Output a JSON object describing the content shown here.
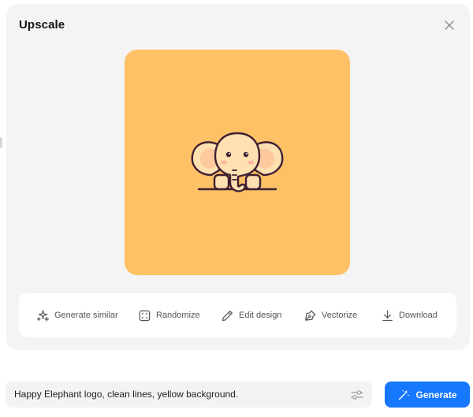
{
  "dialog": {
    "title": "Upscale"
  },
  "preview": {
    "background_color": "#fec166",
    "subject_icon": "elephant-logo"
  },
  "actions": [
    {
      "id": "generate-similar",
      "label": "Generate similar",
      "icon": "sparkles-icon"
    },
    {
      "id": "randomize",
      "label": "Randomize",
      "icon": "dice-icon"
    },
    {
      "id": "edit-design",
      "label": "Edit design",
      "icon": "pencil-icon"
    },
    {
      "id": "vectorize",
      "label": "Vectorize",
      "icon": "pen-nib-icon"
    },
    {
      "id": "download",
      "label": "Download",
      "icon": "download-icon"
    }
  ],
  "prompt": {
    "value": "Happy Elephant logo, clean lines, yellow background."
  },
  "generate": {
    "label": "Generate",
    "color": "#1677ff"
  }
}
